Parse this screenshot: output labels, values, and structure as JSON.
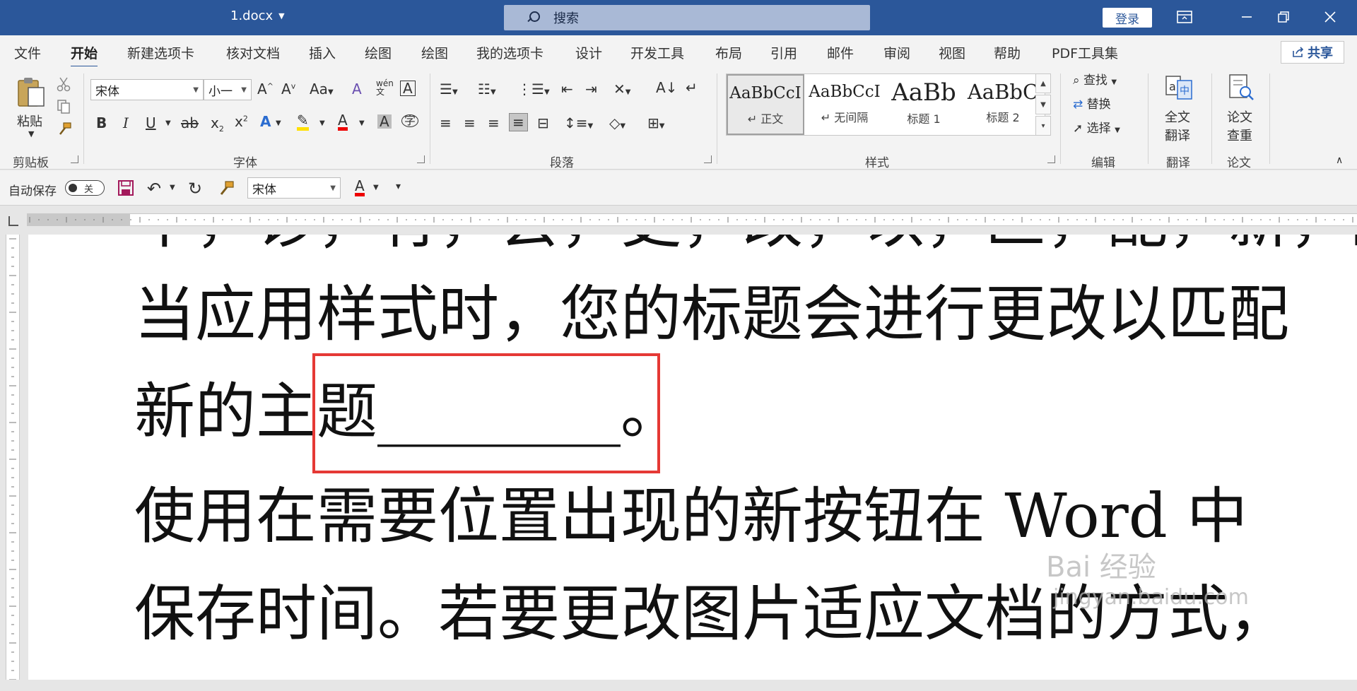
{
  "titlebar": {
    "doc_name": "1.docx",
    "search_placeholder": "搜索",
    "login_label": "登录"
  },
  "tabs": [
    "文件",
    "开始",
    "新建选项卡",
    "核对文档",
    "插入",
    "绘图",
    "绘图",
    "我的选项卡",
    "设计",
    "开发工具",
    "布局",
    "引用",
    "邮件",
    "审阅",
    "视图",
    "帮助",
    "PDF工具集"
  ],
  "active_tab": "开始",
  "share_label": "共享",
  "ribbon": {
    "clipboard": {
      "paste_label": "粘贴",
      "group_label": "剪贴板"
    },
    "font": {
      "font_name": "宋体",
      "font_size": "小一",
      "group_label": "字体"
    },
    "paragraph": {
      "group_label": "段落"
    },
    "styles": {
      "group_label": "样式",
      "items": [
        {
          "preview": "AaBbCcI",
          "name": "正文"
        },
        {
          "preview": "AaBbCcI",
          "name": "无间隔"
        },
        {
          "preview": "AaBb",
          "name": "标题 1"
        },
        {
          "preview": "AaBbC",
          "name": "标题 2"
        }
      ]
    },
    "editing": {
      "find": "查找",
      "replace": "替换",
      "select": "选择",
      "group_label": "编辑"
    },
    "translate": {
      "button_line1": "全文",
      "button_line2": "翻译",
      "group_label": "翻译"
    },
    "paper": {
      "button_line1": "论文",
      "button_line2": "查重",
      "group_label": "论文"
    }
  },
  "qat": {
    "autosave_label": "自动保存",
    "autosave_state": "关",
    "font_name": "宋体"
  },
  "document": {
    "line_cut": "中，诊，有，会，更，改，以，匹，配，新，的，主，题",
    "line1": "当应用样式时，您的标题会进行更改以匹配",
    "line2": "新的主题________。",
    "line3": "使用在需要位置出现的新按钮在 Word 中",
    "line4": "保存时间。若要更改图片适应文档的方式，"
  },
  "watermark": {
    "line1": "Bai 经验",
    "line2": "jingyan.baidu.com"
  }
}
